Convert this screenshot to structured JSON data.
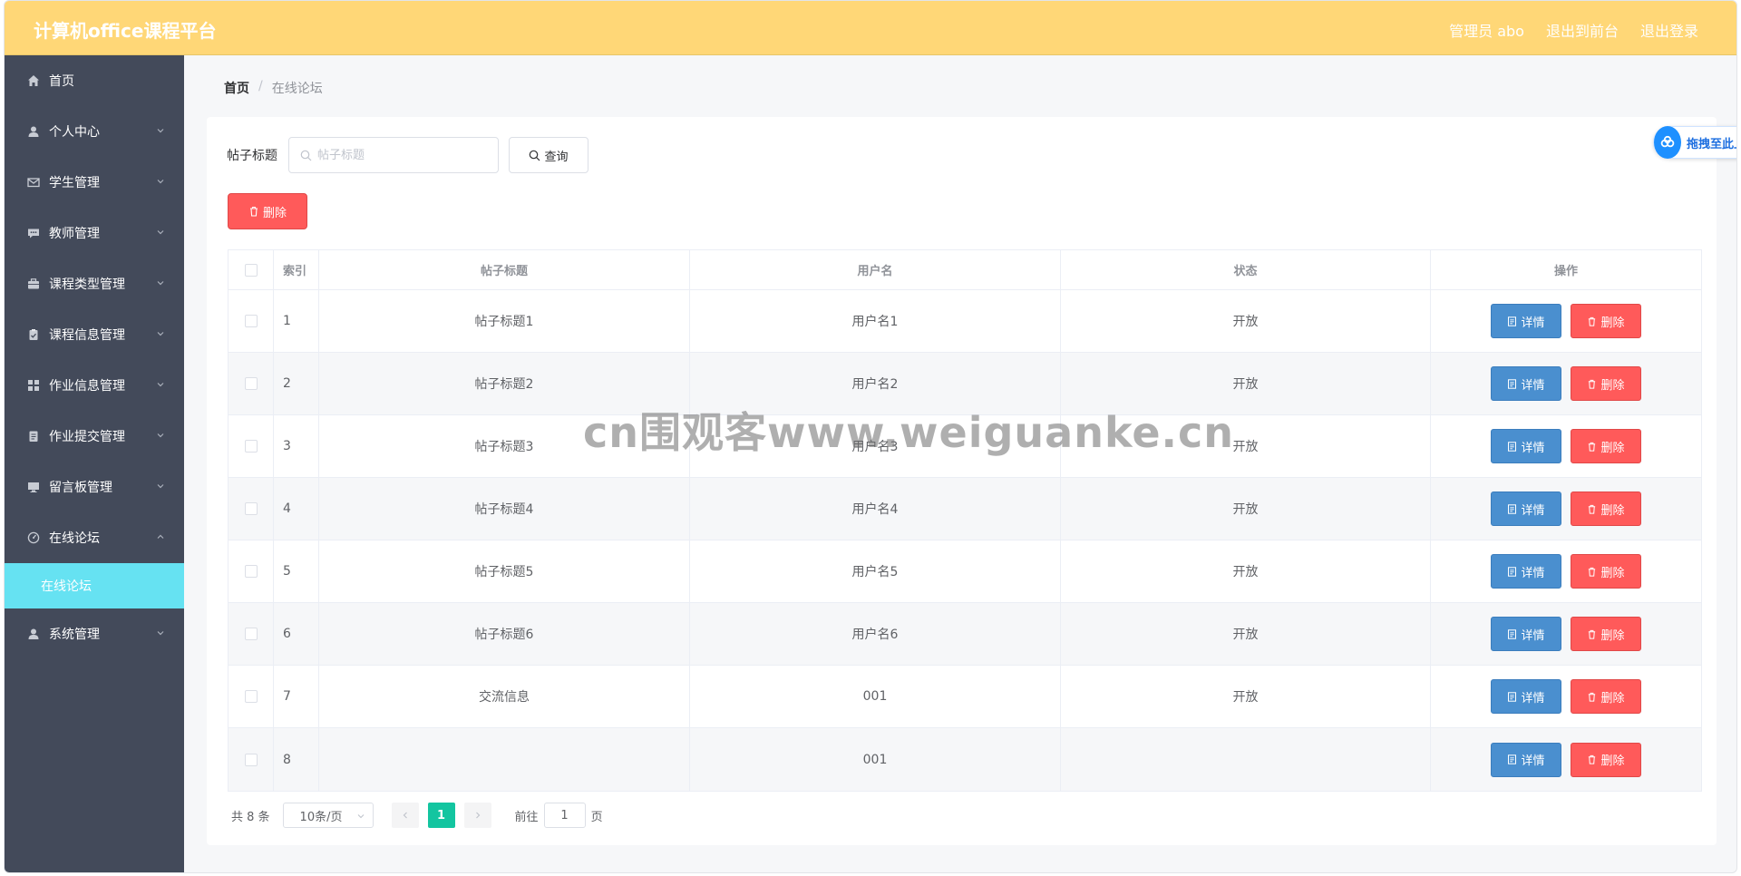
{
  "header": {
    "app_title": "计算机office课程平台",
    "admin_label": "管理员 abo",
    "back_to_front": "退出到前台",
    "logout": "退出登录"
  },
  "sidebar": {
    "items": [
      {
        "label": "首页",
        "icon": "home-icon"
      },
      {
        "label": "个人中心",
        "icon": "user-icon"
      },
      {
        "label": "学生管理",
        "icon": "mail-icon"
      },
      {
        "label": "教师管理",
        "icon": "chat-icon"
      },
      {
        "label": "课程类型管理",
        "icon": "briefcase-icon"
      },
      {
        "label": "课程信息管理",
        "icon": "clipboard-icon"
      },
      {
        "label": "作业信息管理",
        "icon": "grid-icon"
      },
      {
        "label": "作业提交管理",
        "icon": "document-icon"
      },
      {
        "label": "留言板管理",
        "icon": "monitor-icon"
      },
      {
        "label": "在线论坛",
        "icon": "gauge-icon"
      },
      {
        "label": "系统管理",
        "icon": "user-icon"
      }
    ],
    "active_sub": "在线论坛"
  },
  "breadcrumb": {
    "home": "首页",
    "sep": "/",
    "current": "在线论坛"
  },
  "search": {
    "label": "帖子标题",
    "placeholder": "帖子标题",
    "button": "查询"
  },
  "batch_delete": "删除",
  "table": {
    "headers": [
      "索引",
      "帖子标题",
      "用户名",
      "状态",
      "操作"
    ],
    "rows": [
      {
        "index": "1",
        "title": "帖子标题1",
        "user": "用户名1",
        "status": "开放"
      },
      {
        "index": "2",
        "title": "帖子标题2",
        "user": "用户名2",
        "status": "开放"
      },
      {
        "index": "3",
        "title": "帖子标题3",
        "user": "用户名3",
        "status": "开放"
      },
      {
        "index": "4",
        "title": "帖子标题4",
        "user": "用户名4",
        "status": "开放"
      },
      {
        "index": "5",
        "title": "帖子标题5",
        "user": "用户名5",
        "status": "开放"
      },
      {
        "index": "6",
        "title": "帖子标题6",
        "user": "用户名6",
        "status": "开放"
      },
      {
        "index": "7",
        "title": "交流信息",
        "user": "001",
        "status": "开放"
      },
      {
        "index": "8",
        "title": "",
        "user": "001",
        "status": ""
      }
    ],
    "detail_label": "详情",
    "delete_label": "删除"
  },
  "pagination": {
    "total": "共 8 条",
    "page_size": "10条/页",
    "current_page": "1",
    "goto_label": "前往",
    "goto_value": "1",
    "page_suffix": "页"
  },
  "float_widget": {
    "label": "拖拽至此上"
  },
  "watermark": "cn围观客www.weiguanke.cn",
  "colors": {
    "header_bg": "#ffd777",
    "sidebar_bg": "#434a5a",
    "active_sub_bg": "#66e2f2",
    "danger": "#ff5a5a",
    "primary": "#4a8fcf",
    "page_active": "#13c5a0"
  }
}
